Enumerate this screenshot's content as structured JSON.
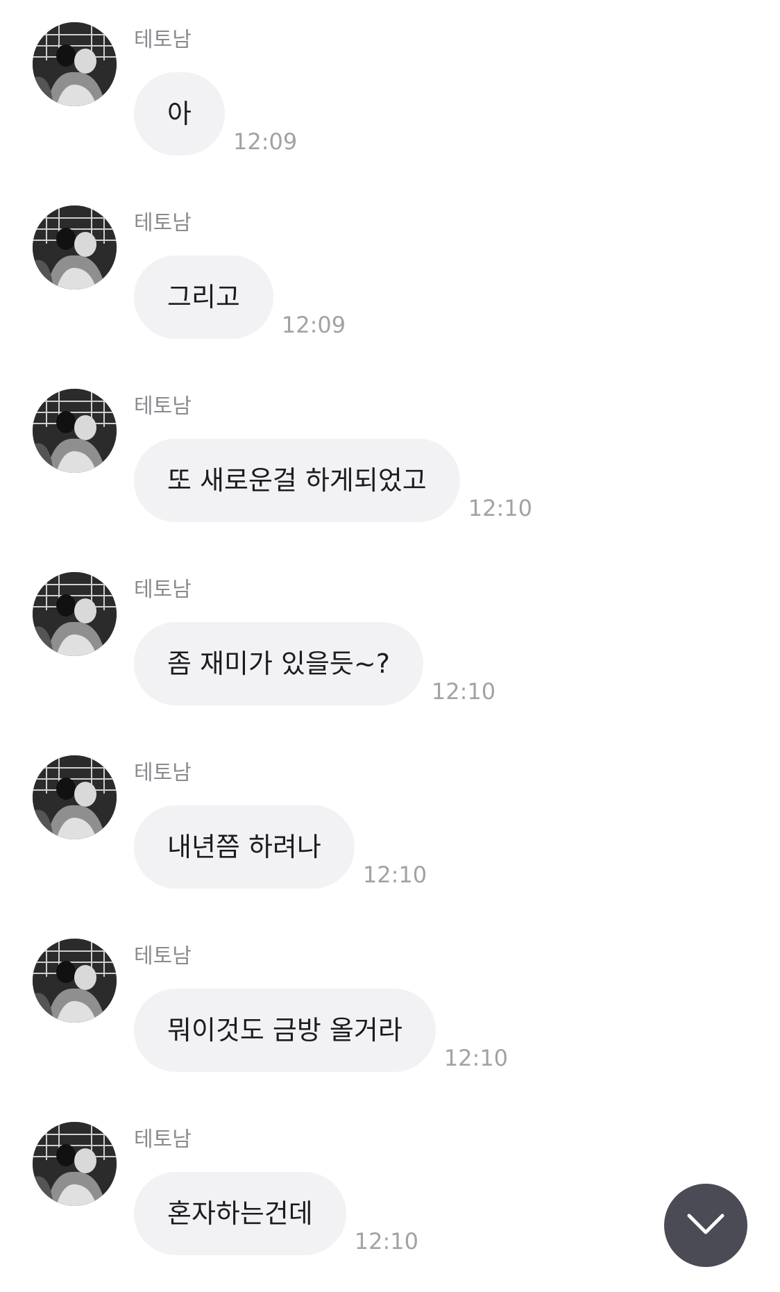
{
  "chat": {
    "messages": [
      {
        "sender": "테토남",
        "text": "아",
        "time": "12:09"
      },
      {
        "sender": "테토남",
        "text": "그리고",
        "time": "12:09"
      },
      {
        "sender": "테토남",
        "text": "또 새로운걸 하게되었고",
        "time": "12:10"
      },
      {
        "sender": "테토남",
        "text": "좀 재미가 있을듯~?",
        "time": "12:10"
      },
      {
        "sender": "테토남",
        "text": "내년쯤 하려나",
        "time": "12:10"
      },
      {
        "sender": "테토남",
        "text": "뭐이것도 금방 올거라",
        "time": "12:10"
      },
      {
        "sender": "테토남",
        "text": "혼자하는건데",
        "time": "12:10"
      }
    ]
  },
  "scroll_button": {
    "icon": "chevron-down-icon"
  },
  "colors": {
    "background": "#ffffff",
    "bubble": "#f2f2f4",
    "message_text": "#1c1c1e",
    "sender_text": "#8a8a8e",
    "time_text": "#a2a2a6",
    "scroll_button": "#4a4b55"
  }
}
